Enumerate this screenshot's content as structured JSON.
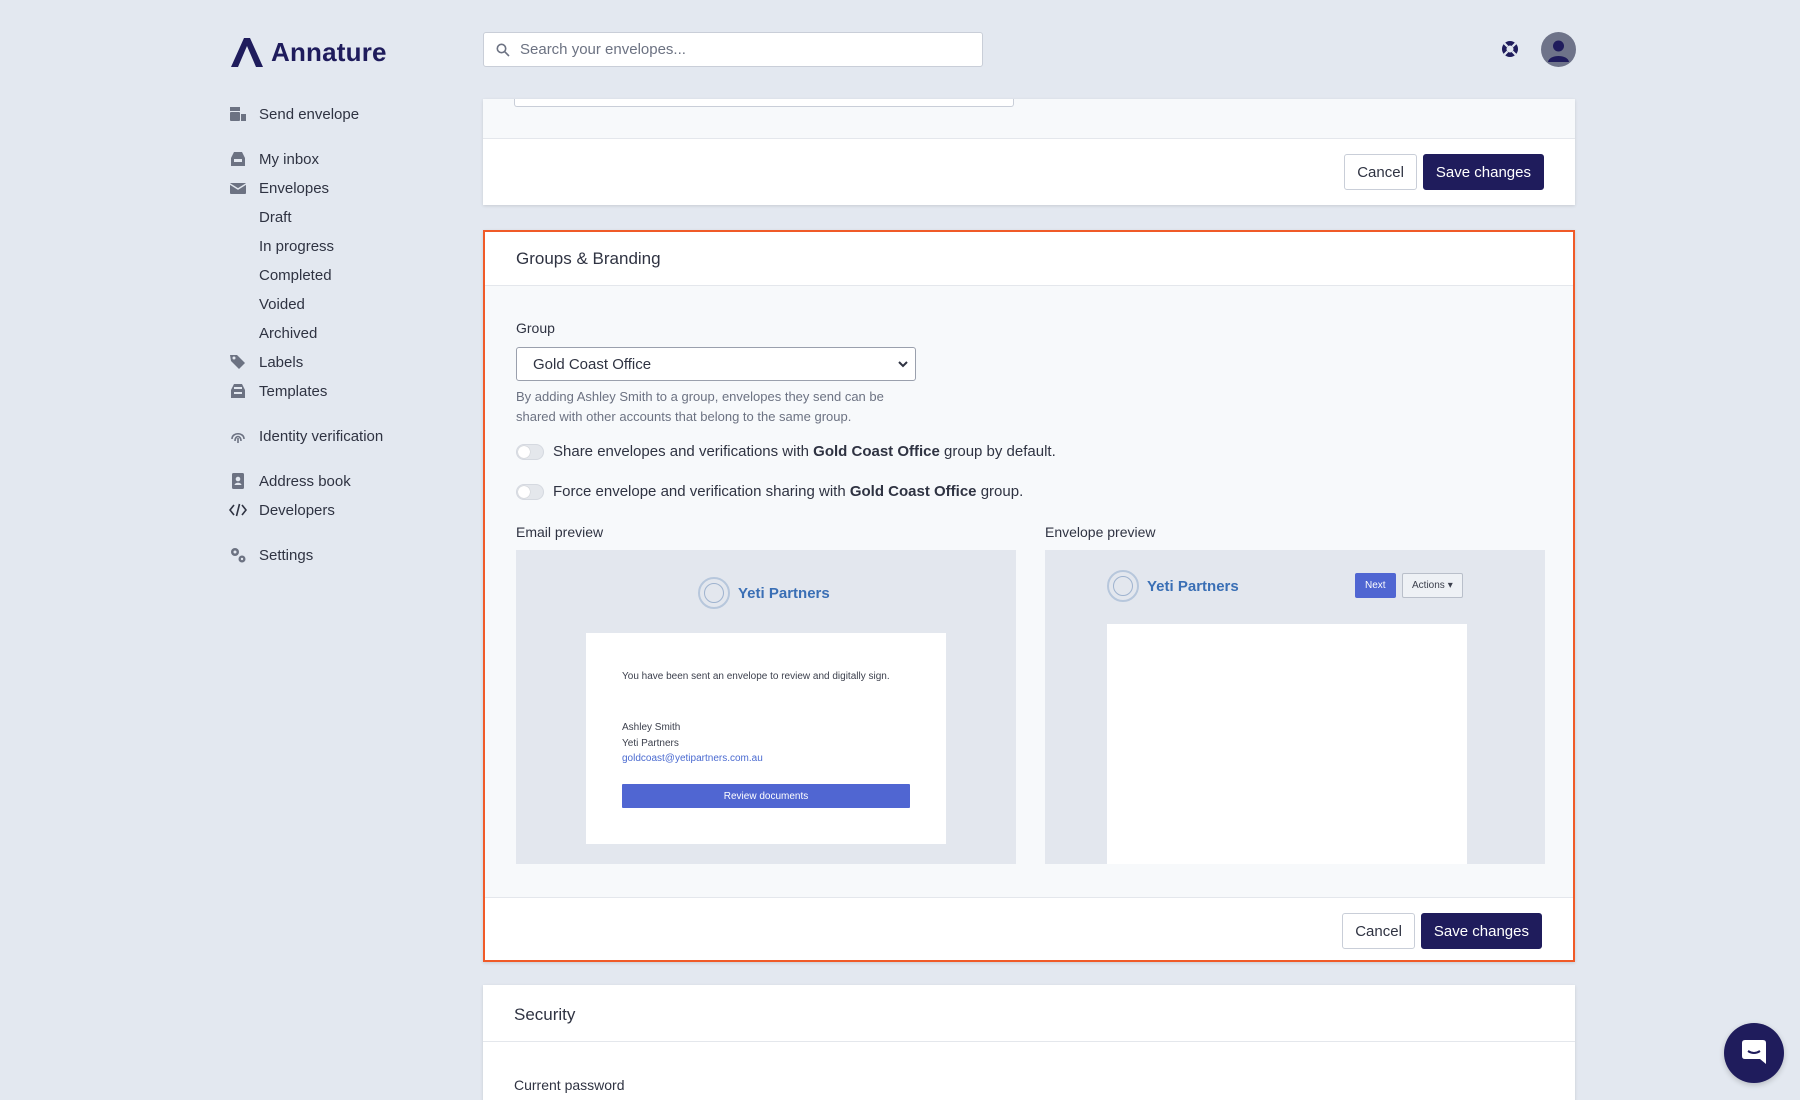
{
  "app": {
    "name": "Annature"
  },
  "search": {
    "placeholder": "Search your envelopes..."
  },
  "sidebar": {
    "items": [
      {
        "label": "Send envelope",
        "icon": "send-envelope-icon"
      },
      {
        "label": "My inbox",
        "icon": "inbox-icon"
      },
      {
        "label": "Envelopes",
        "icon": "envelope-icon"
      },
      {
        "label": "Draft"
      },
      {
        "label": "In progress"
      },
      {
        "label": "Completed"
      },
      {
        "label": "Voided"
      },
      {
        "label": "Archived"
      },
      {
        "label": "Labels",
        "icon": "tag-icon"
      },
      {
        "label": "Templates",
        "icon": "templates-icon"
      },
      {
        "label": "Identity verification",
        "icon": "fingerprint-icon"
      },
      {
        "label": "Address book",
        "icon": "address-book-icon"
      },
      {
        "label": "Developers",
        "icon": "code-icon"
      },
      {
        "label": "Settings",
        "icon": "gear-icon"
      }
    ]
  },
  "top_card": {
    "cancel_label": "Cancel",
    "save_label": "Save changes"
  },
  "groups_branding": {
    "title": "Groups & Branding",
    "group_label": "Group",
    "group_selected": "Gold Coast Office",
    "help_text": "By adding Ashley Smith to a group, envelopes they send can be shared with other accounts that belong to the same group.",
    "toggle_share": {
      "prefix": "Share envelopes and verifications with",
      "group": "Gold Coast Office",
      "suffix": "group by default.",
      "on": false
    },
    "toggle_force": {
      "prefix": "Force envelope and verification sharing with",
      "group": "Gold Coast Office",
      "suffix": "group.",
      "on": false
    },
    "email_preview": {
      "label": "Email preview",
      "brand_name": "Yeti Partners",
      "intro": "You have been sent an envelope to review and digitally sign.",
      "sender_name": "Ashley Smith",
      "sender_company": "Yeti Partners",
      "sender_email": "goldcoast@yetipartners.com.au",
      "button_label": "Review documents"
    },
    "envelope_preview": {
      "label": "Envelope preview",
      "brand_name": "Yeti Partners",
      "next_label": "Next",
      "actions_label": "Actions"
    },
    "cancel_label": "Cancel",
    "save_label": "Save changes"
  },
  "security": {
    "title": "Security",
    "current_password_label": "Current password"
  },
  "colors": {
    "brand": "#1f1c5c",
    "accent": "#5066d2",
    "highlight_border": "#f05a28",
    "background": "#e3e8f0"
  }
}
